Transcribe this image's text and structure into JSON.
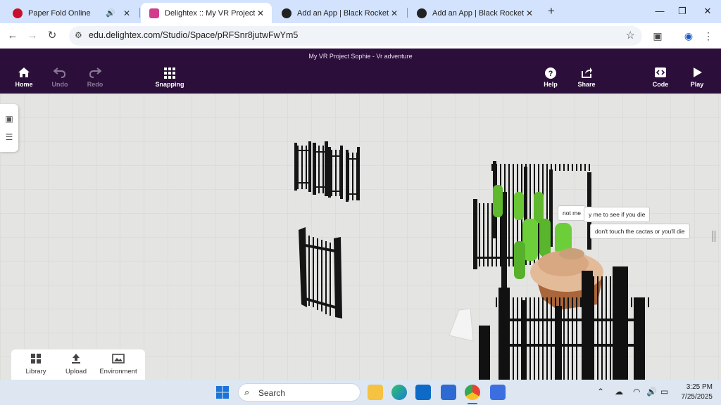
{
  "browser": {
    "tabs": [
      {
        "title": "Paper Fold Online",
        "favicon_color": "#c8102e",
        "audio": true
      },
      {
        "title": "Delightex :: My VR Project Sophi",
        "favicon_color": "#d23c8c",
        "active": true
      },
      {
        "title": "Add an App | Black Rocket Arca",
        "favicon_color": "#222222"
      },
      {
        "title": "Add an App | Black Rocket Arca",
        "favicon_color": "#222222"
      }
    ],
    "new_tab": "+",
    "window_controls": {
      "minimize": "—",
      "restore": "❐",
      "close": "✕"
    },
    "url": "edu.delightex.com/Studio/Space/pRFSnr8jutwFwYm5"
  },
  "app": {
    "project_title": "My VR Project Sophie - Vr adventure",
    "header_buttons": {
      "home": "Home",
      "undo": "Undo",
      "redo": "Redo",
      "snapping": "Snapping",
      "help": "Help",
      "share": "Share",
      "code": "Code",
      "play": "Play"
    },
    "speech_bubbles": {
      "bubble1": "not me",
      "bubble2": "y me to see if you die",
      "bubble3": "don't touch the cactas or you'll die"
    },
    "bottom_panel": {
      "library": "Library",
      "upload": "Upload",
      "environment": "Environment"
    }
  },
  "taskbar": {
    "search_placeholder": "Search",
    "time": "3:25 PM",
    "date": "7/25/2025"
  }
}
